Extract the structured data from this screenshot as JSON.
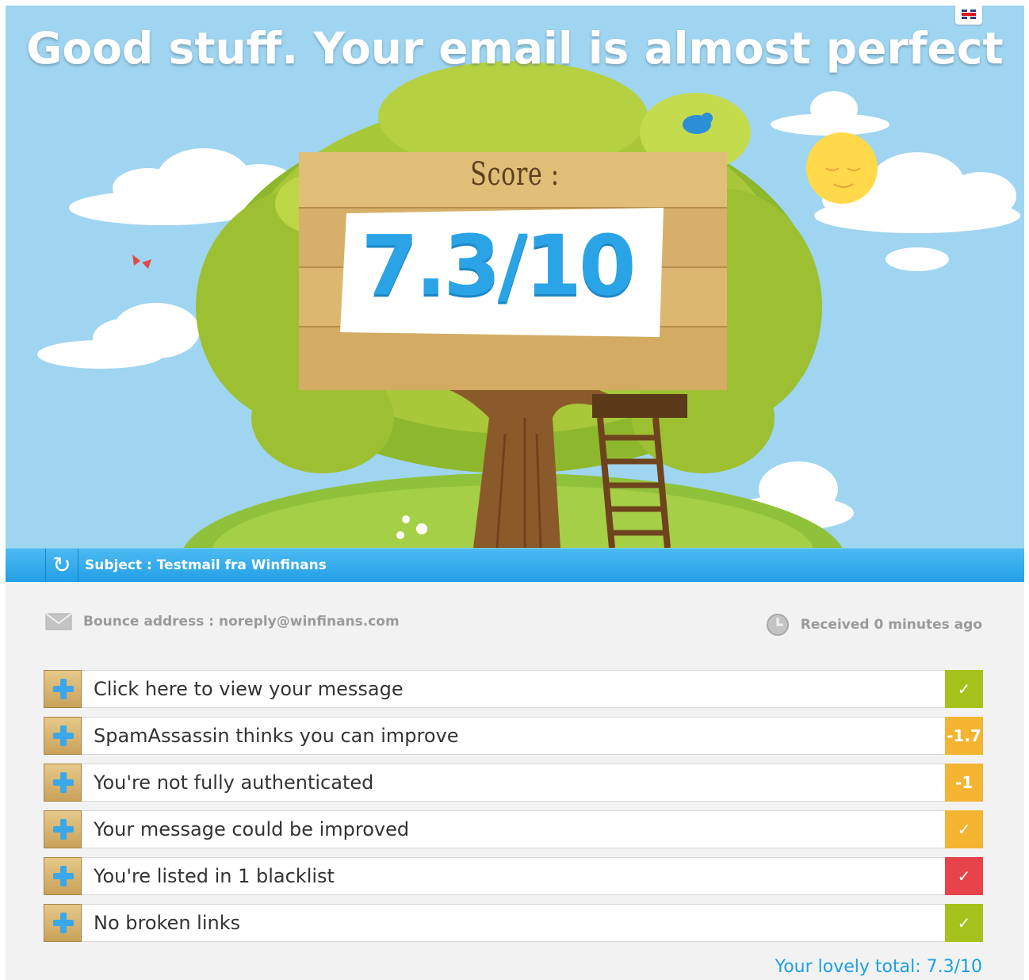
{
  "hero": {
    "headline": "Good stuff. Your email is almost perfect",
    "score_label": "Score :",
    "score_value": "7.3/10"
  },
  "subject_bar": {
    "text": "Subject : Testmail fra Winfinans"
  },
  "meta": {
    "bounce": "Bounce address : noreply@winfinans.com",
    "received": "Received 0 minutes ago"
  },
  "checks": [
    {
      "label": "Click here to view your message",
      "badge": "✓",
      "color": "#a5c21c"
    },
    {
      "label": "SpamAssassin thinks you can improve",
      "badge": "-1.7",
      "color": "#f2b431"
    },
    {
      "label": "You're not fully authenticated",
      "badge": "-1",
      "color": "#f2b431"
    },
    {
      "label": "Your message could be improved",
      "badge": "✓",
      "color": "#f2b431"
    },
    {
      "label": "You're listed in 1 blacklist",
      "badge": "✓",
      "color": "#e8434b"
    },
    {
      "label": "No broken links",
      "badge": "✓",
      "color": "#a5c21c"
    }
  ],
  "total": "Your lovely total: 7.3/10",
  "icons": [
    "uk-flag-icon",
    "refresh-icon",
    "envelope-icon",
    "clock-icon",
    "plus-icon",
    "check-icon"
  ]
}
